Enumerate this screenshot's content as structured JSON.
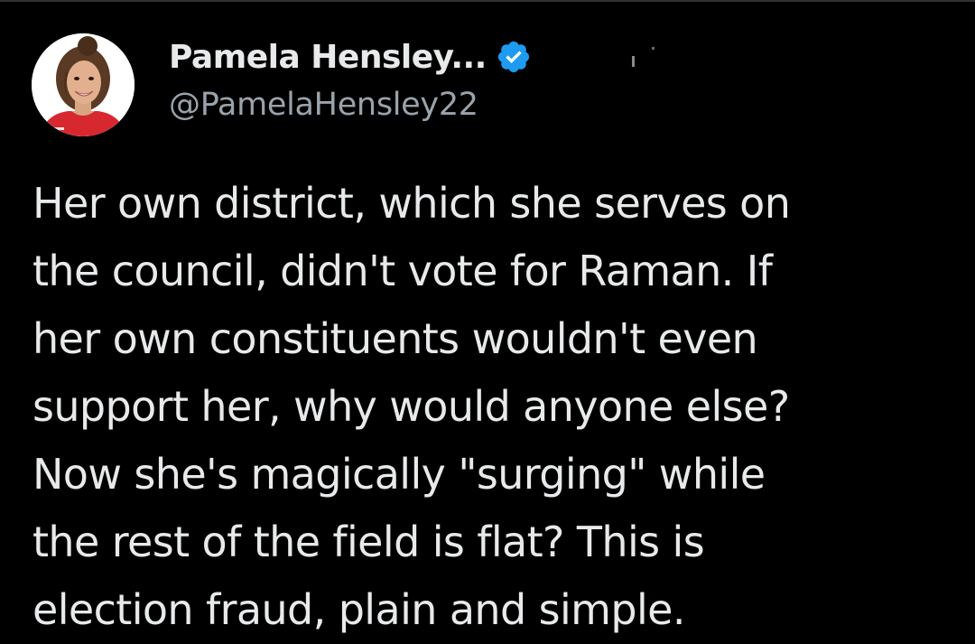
{
  "author": {
    "display_name": "Pamela Hensley...",
    "handle": "@PamelaHensley22",
    "verified_icon": "verified-badge-icon",
    "avatar_icon": "profile-photo"
  },
  "tweet": {
    "lines": [
      "Her own district, which she serves on",
      "the council, didn't vote for Raman. If",
      "her own constituents wouldn't even",
      "support her, why would anyone else?",
      "Now she's magically \"surging\" while",
      "the rest of the field is flat? This is",
      "election fraud, plain and simple."
    ]
  },
  "colors": {
    "background": "#000000",
    "text_primary": "#e7e9ea",
    "text_secondary": "#9aa3ab",
    "verified_blue": "#1d9bf0"
  }
}
